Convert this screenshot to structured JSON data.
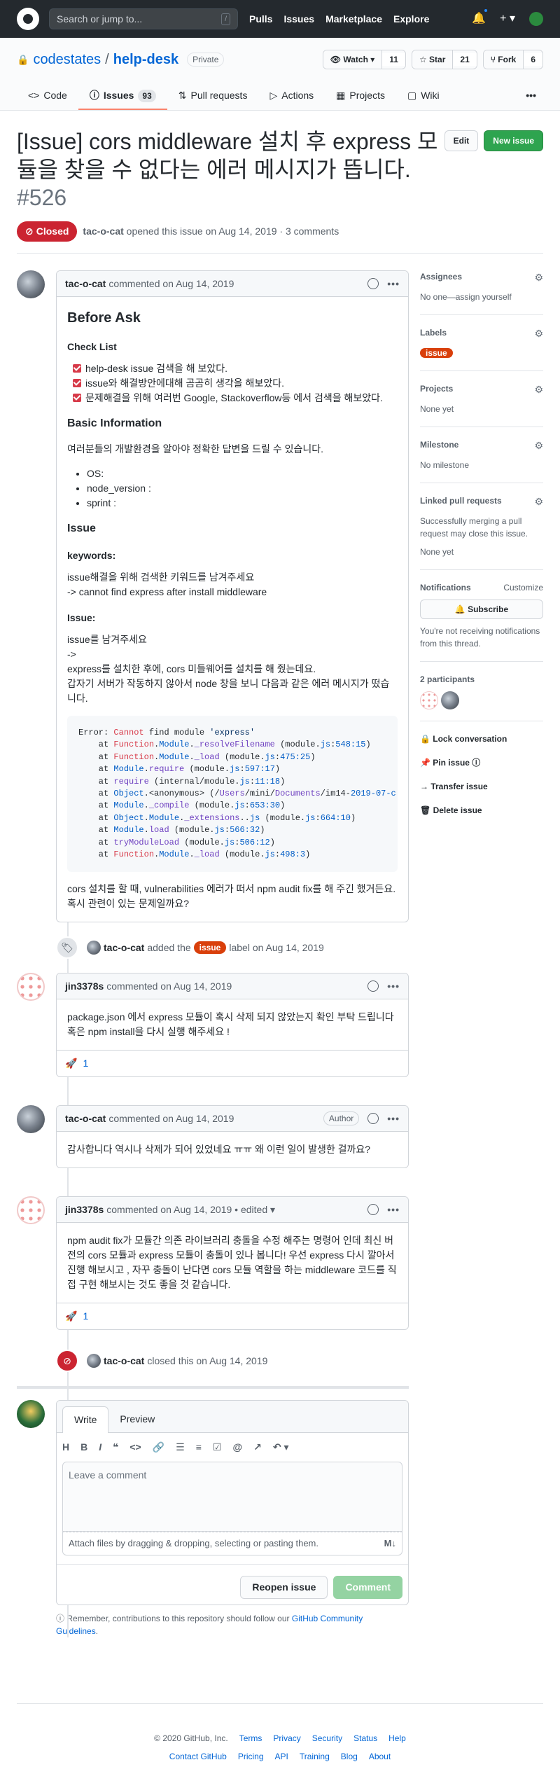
{
  "header": {
    "search_placeholder": "Search or jump to...",
    "slash": "/",
    "nav": [
      "Pulls",
      "Issues",
      "Marketplace",
      "Explore"
    ],
    "plus": "+ ▾"
  },
  "repo": {
    "owner": "codestates",
    "sep": "/",
    "name": "help-desk",
    "visibility": "Private",
    "watch_label": "Watch ▾",
    "watch_count": "11",
    "star_label": "Star",
    "star_count": "21",
    "fork_label": "Fork",
    "fork_count": "6",
    "tabs": [
      {
        "label": "Code",
        "icon": "<>"
      },
      {
        "label": "Issues",
        "count": "93",
        "icon": "ⓘ"
      },
      {
        "label": "Pull requests",
        "icon": "⇅"
      },
      {
        "label": "Actions",
        "icon": "▷"
      },
      {
        "label": "Projects",
        "icon": "▦"
      },
      {
        "label": "Wiki",
        "icon": "▢"
      }
    ],
    "more": "•••"
  },
  "issue": {
    "title": "[Issue] cors middleware 설치 후 express 모듈을 찾을 수 없다는 에러 메시지가 뜹니다.",
    "number": "#526",
    "edit": "Edit",
    "new_issue": "New issue",
    "status": "Closed",
    "author": "tac-o-cat",
    "meta": "opened this issue on Aug 14, 2019 · 3 comments"
  },
  "first_comment": {
    "author": "tac-o-cat",
    "date": "commented on Aug 14, 2019",
    "h_before": "Before Ask",
    "h_check": "Check List",
    "checks": [
      "help-desk issue 검색을 해 보았다.",
      "issue와 해결방안에대해 곰곰히 생각을 해보았다.",
      "문제해결을 위해 여러번 Google, Stackoverflow등 에서 검색을 해보았다."
    ],
    "h_basic": "Basic Information",
    "basic_text": "여러분들의 개발환경을 알아야 정확한 답변을 드릴 수 있습니다.",
    "env": [
      "OS:",
      "node_version :",
      "sprint :"
    ],
    "h_issue": "Issue",
    "h_keywords": "keywords:",
    "kw_1": "issue해결을 위해 검색한 키워드를 남겨주세요",
    "kw_2": "-> cannot find express after install middleware",
    "h_issue2": "Issue:",
    "is_1": "issue를 남겨주세요",
    "is_2": "->",
    "is_3": "express를 설치한 후에, cors 미들웨어를 설치를 해 줬는데요.",
    "is_4": "갑자기 서버가 작동하지 않아서 node 창을 보니 다음과 같은 에러 메시지가 떴습니다.",
    "outro": "cors 설치를 할 때, vulnerabilities 에러가 떠서 npm audit fix를 해 주긴 했거든요. 혹시 관련이 있는 문제일까요?"
  },
  "events": {
    "labeled_user": "tac-o-cat",
    "labeled_pre": "added the",
    "label_name": "issue",
    "labeled_post": "label on Aug 14, 2019",
    "closed_user": "tac-o-cat",
    "closed_text": "closed this on Aug 14, 2019"
  },
  "comments": [
    {
      "author": "jin3378s",
      "date": "commented on Aug 14, 2019",
      "body": "package.json 에서 express 모듈이 혹시 삭제 되지 않았는지 확인 부탁 드립니다 혹은 npm install을 다시 실행 해주세요 !",
      "reaction": "🚀",
      "count": "1"
    },
    {
      "author": "tac-o-cat",
      "date": "commented on Aug 14, 2019",
      "badge": "Author",
      "body": "감사합니다 역시나 삭제가 되어 있었네요 ㅠㅠ 왜 이런 일이 발생한 걸까요?"
    },
    {
      "author": "jin3378s",
      "date": "commented on Aug 14, 2019 • edited ▾",
      "body": "npm audit fix가 모듈간 의존 라이브러리 충돌을 수정 해주는 명령어 인데 최신 버전의 cors 모듈과 express 모듈이 충돌이 있나 봅니다! 우선 express 다시 깔아서 진행 해보시고 , 자꾸 충돌이 난다면 cors 모듈 역할을 하는 middleware 코드를 직접 구현 해보시는 것도 좋을 것 같습니다.",
      "reaction": "🚀",
      "count": "1"
    }
  ],
  "new_comment": {
    "tab_write": "Write",
    "tab_preview": "Preview",
    "tools": [
      "H",
      "B",
      "I",
      "❝",
      "<>",
      "🔗",
      "☰",
      "≡",
      "☑",
      "@",
      "↗",
      "↶ ▾"
    ],
    "placeholder": "Leave a comment",
    "attach": "Attach files by dragging & dropping, selecting or pasting them.",
    "md": "M↓",
    "reopen": "Reopen issue",
    "submit": "Comment",
    "remember_pre": "Remember, contributions to this repository should follow our",
    "remember_link": "GitHub Community Guidelines",
    "remember_post": "."
  },
  "sidebar": {
    "assignees": "Assignees",
    "assignees_val": "No one—assign yourself",
    "labels": "Labels",
    "label_val": "issue",
    "projects": "Projects",
    "projects_val": "None yet",
    "milestone": "Milestone",
    "milestone_val": "No milestone",
    "linked": "Linked pull requests",
    "linked_desc": "Successfully merging a pull request may close this issue.",
    "linked_val": "None yet",
    "notifications": "Notifications",
    "customize": "Customize",
    "subscribe": "🔔 Subscribe",
    "notif_desc": "You're not receiving notifications from this thread.",
    "participants": "2 participants",
    "lock": "🔒 Lock conversation",
    "pin": "📌 Pin issue ⓘ",
    "transfer": "→ Transfer issue",
    "delete": "🗑 Delete issue"
  },
  "footer": {
    "row1": [
      "© 2020 GitHub, Inc.",
      "Terms",
      "Privacy",
      "Security",
      "Status",
      "Help"
    ],
    "row2": [
      "Contact GitHub",
      "Pricing",
      "API",
      "Training",
      "Blog",
      "About"
    ]
  }
}
